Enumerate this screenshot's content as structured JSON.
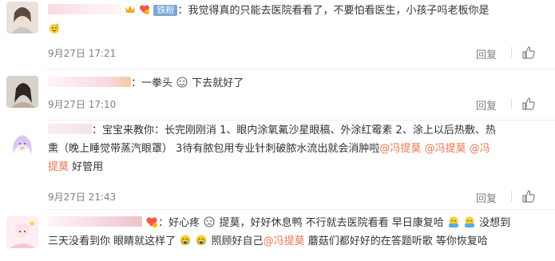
{
  "comments": [
    {
      "colon": "：",
      "text": "我觉得真的只能去医院看看了，不要怕看医生，小孩子吗老板你是",
      "fan_badge": "铁粉",
      "time": "9月27日 17:21",
      "reply_label": "回复"
    },
    {
      "colon": "：",
      "text_a": "一拳头",
      "text_b": " 下去就好了",
      "time": "9月27日 17:10",
      "reply_label": "回复"
    },
    {
      "colon": "：",
      "text_a": "宝宝来教你：长完刚刚消 1、眼内涂氧氟沙星眼稿、外涂红霉素 2、涂上以后热敷、热",
      "text_b": "熏（晚上睡觉带蒸汽眼罩） 3待有脓包用专业针刺破脓水流出就会消肿啦",
      "mention_1": "@冯提莫",
      "mention_2": "@冯提莫",
      "mention_3a": "@冯",
      "mention_3b": "提莫",
      "text_c": " 好管用",
      "time": "9月27日 21:43",
      "reply_label": "回复"
    },
    {
      "colon": "：",
      "text_a": "好心疼",
      "text_b": " 提莫，好好休息鸭 不行就去医院看看 早日康复哈",
      "text_c": " 没想到",
      "text_d": "三天没看到你 眼睛就这样了",
      "text_e": " 照顾好自己",
      "mention": "@冯提莫",
      "text_f": "  蘑菇们都好好的在答题听歌 等你恢复哈"
    }
  ],
  "colors": {
    "mention": "#eb7350",
    "meta": "#808080",
    "fan_badge_bg": "#7ea7d6"
  },
  "icons": [
    "vip-crown-icon",
    "fan-heart-icon",
    "sweat-emoji-icon",
    "smile-emoji-icon",
    "cry-emoji-icon",
    "hug-emoji-icon",
    "thumbs-up-icon"
  ]
}
